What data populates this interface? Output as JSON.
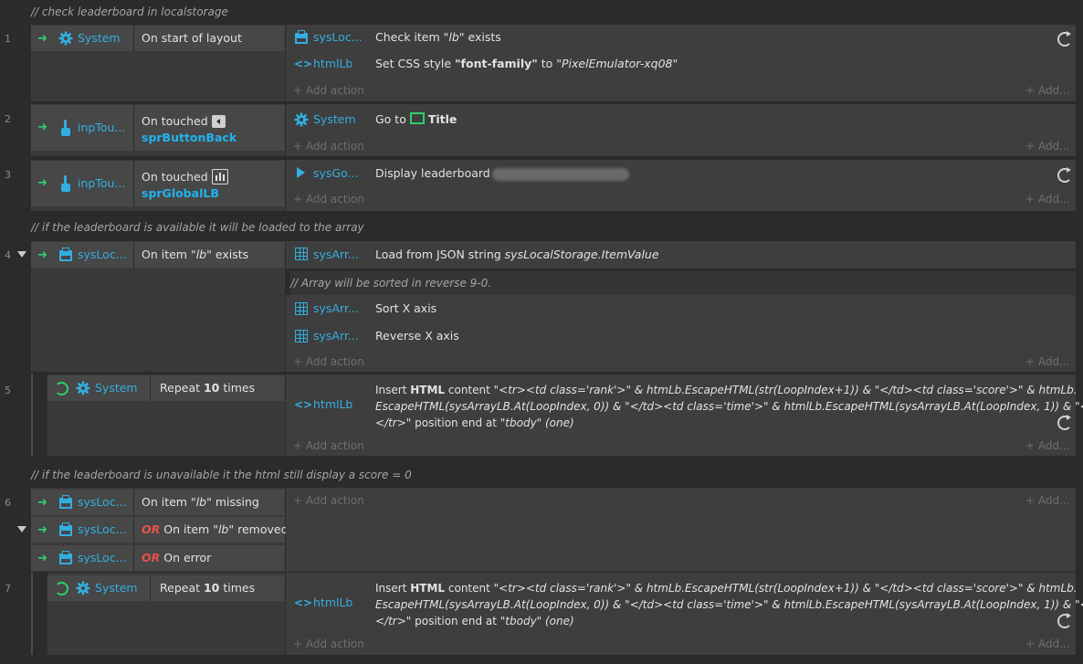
{
  "comments": [
    "//  check leaderboard in localstorage",
    "//  if the leaderboard is available it will be loaded to the array",
    "//  Array will be sorted in reverse 9-0.",
    "//  if the leaderboard is unavailable it the html still display a score = 0"
  ],
  "line_numbers": [
    "1",
    "2",
    "3",
    "4",
    "5",
    "6",
    "7"
  ],
  "add_action": "+ Add action",
  "add_more": "+ Add...",
  "events": {
    "e1": {
      "cond_obj": "System",
      "cond_text": "On start of layout",
      "actions": [
        {
          "obj": "sysLoc...",
          "text_pre": "Check item ",
          "text_em": "\"lb\"",
          "text_post": " exists"
        },
        {
          "obj": "htmlLb",
          "text_pre": "Set CSS style ",
          "text_bold": "\"font-family\"",
          "text_mid": " to ",
          "text_em": "\"PixelEmulator-xq08\""
        }
      ]
    },
    "e2": {
      "cond_obj": "inpTou...",
      "cond_text": "On touched",
      "cond_sub": "sprButtonBack",
      "action_obj": "System",
      "action_pre": "Go to",
      "action_bold": "Title"
    },
    "e3": {
      "cond_obj": "inpTou...",
      "cond_text": "On touched",
      "cond_sub": "sprGlobalLB",
      "action_obj": "sysGo...",
      "action_text": "Display leaderboard"
    },
    "e4": {
      "cond_obj": "sysLoc...",
      "cond_pre": "On item ",
      "cond_em": "\"lb\"",
      "cond_post": " exists",
      "actions": [
        {
          "obj": "sysArr...",
          "pre": "Load from JSON string ",
          "em": "sysLocalStorage.ItemValue"
        },
        {
          "obj": "sysArr...",
          "pre": "Sort X axis"
        },
        {
          "obj": "sysArr...",
          "pre": "Reverse X axis"
        }
      ]
    },
    "e5": {
      "cond_obj": "System",
      "cond_pre": "Repeat ",
      "cond_bold": "10",
      "cond_post": " times",
      "action_obj": "htmlLb",
      "line1_pre": "Insert ",
      "line1_bold": "HTML",
      "line1_mid": " content ",
      "line1_code": "\"<tr><td class='rank'>\" & htmLb.EscapeHTML(str(LoopIndex+1)) & \"</td><td class='score'>\" & htmLb.",
      "line2_code": "EscapeHTML(sysArrayLB.At(LoopIndex, 0)) & \"</td><td class='time'>\" & htmlLb.EscapeHTML(sysArrayLB.At(LoopIndex, 1)) & \"</td>",
      "line3_code": "</tr>\"",
      "line3_post": " position end at ",
      "line3_em": "\"tbody\" (one)"
    },
    "e6": {
      "conds": [
        {
          "obj": "sysLoc...",
          "or": "",
          "pre": "On item ",
          "em": "\"lb\"",
          "post": " missing"
        },
        {
          "obj": "sysLoc...",
          "or": "OR",
          "pre": " On item ",
          "em": "\"lb\"",
          "post": " removed"
        },
        {
          "obj": "sysLoc...",
          "or": "OR",
          "pre": " On error",
          "em": "",
          "post": ""
        }
      ]
    },
    "e7": {
      "cond_obj": "System",
      "cond_pre": "Repeat ",
      "cond_bold": "10",
      "cond_post": " times",
      "action_obj": "htmlLb",
      "line1_pre": "Insert ",
      "line1_bold": "HTML",
      "line1_mid": " content ",
      "line1_code": "\"<tr><td class='rank'>\" & htmLb.EscapeHTML(str(LoopIndex+1)) & \"</td><td class='score'>\" & htmLb.",
      "line2_code": "EscapeHTML(sysArrayLB.At(LoopIndex, 0)) & \"</td><td class='time'>\" & htmlLb.EscapeHTML(sysArrayLB.At(LoopIndex, 1)) & \"</td>",
      "line3_code": "</tr>\"",
      "line3_post": " position end at ",
      "line3_em": "\"tbody\" (one)"
    }
  },
  "colors": {
    "object": "#32aee0",
    "trigger_arrow": "#2ecf6b",
    "or": "#e8514e",
    "sub_object": "#1fb3ef"
  }
}
